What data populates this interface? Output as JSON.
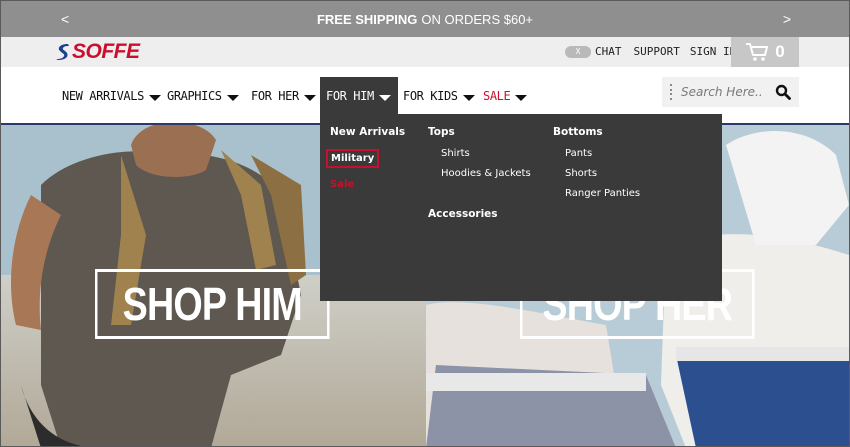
{
  "promo": {
    "bold": "FREE SHIPPING",
    "rest": "ON ORDERS $60+",
    "prev": "<",
    "next": ">"
  },
  "brand": {
    "name": "SOFFE",
    "color": "#c8102e"
  },
  "utility": {
    "chat_badge": "X",
    "chat": "CHAT",
    "support": "SUPPORT",
    "sign_in": "SIGN IN",
    "cart_count": "0"
  },
  "nav": {
    "items": [
      {
        "label": "NEW ARRIVALS"
      },
      {
        "label": "GRAPHICS"
      },
      {
        "label": "FOR HER"
      },
      {
        "label": "FOR HIM"
      },
      {
        "label": "FOR KIDS"
      },
      {
        "label": "SALE"
      }
    ],
    "active": "FOR HIM"
  },
  "search": {
    "placeholder": "Search Here.."
  },
  "dropdown": {
    "col1": {
      "head": "New Arrivals",
      "highlight": "Military",
      "sale": "Sale"
    },
    "col2": {
      "head": "Tops",
      "items": [
        "Shirts",
        "Hoodies & Jackets"
      ],
      "head2": "Accessories"
    },
    "col3": {
      "head": "Bottoms",
      "items": [
        "Pants",
        "Shorts",
        "Ranger Panties"
      ]
    }
  },
  "hero": {
    "left_cta": "SHOP HIM",
    "right_cta": "SHOP HER"
  },
  "icons": [
    "chat-icon",
    "cart-icon",
    "search-icon",
    "caret-down-icon"
  ]
}
